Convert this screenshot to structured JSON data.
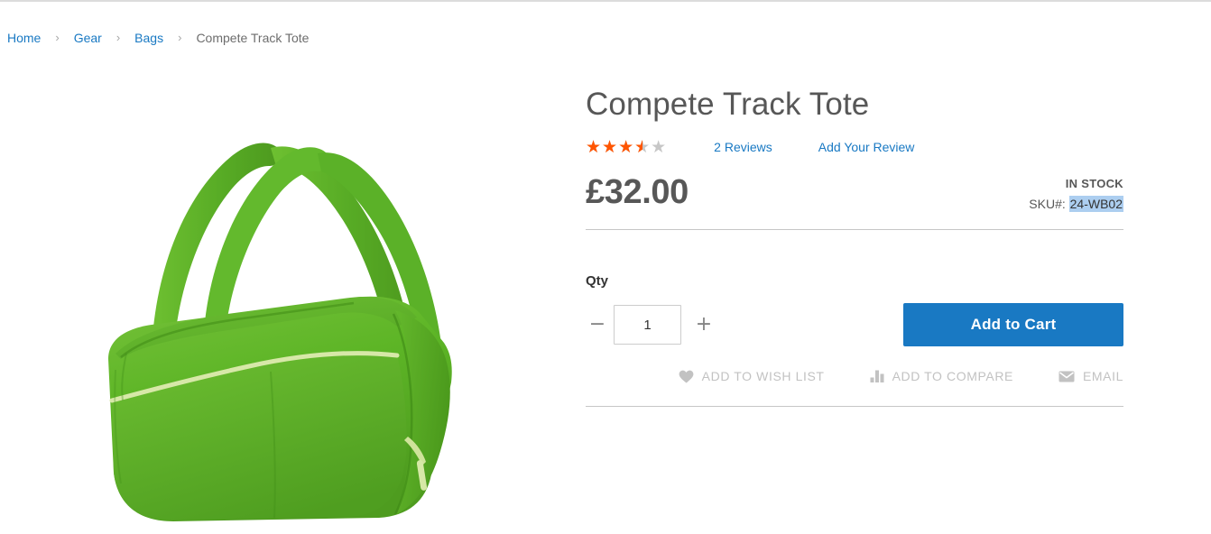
{
  "breadcrumb": {
    "separator": "›",
    "items": [
      {
        "label": "Home",
        "type": "link"
      },
      {
        "label": "Gear",
        "type": "link"
      },
      {
        "label": "Bags",
        "type": "link"
      },
      {
        "label": "Compete Track Tote",
        "type": "current"
      }
    ]
  },
  "product": {
    "title": "Compete Track Tote",
    "image_alt": "Compete Track Tote green duffel bag",
    "rating": {
      "stars_glyphs": "★★★★★",
      "value": 3.5,
      "max": 5,
      "percent": "70%",
      "filled_color": "#ff5501",
      "empty_color": "#c7c7c7"
    },
    "reviews_link": "2 Reviews",
    "add_review_link": "Add Your Review",
    "price": "£32.00",
    "stock_status": "IN STOCK",
    "sku_label": "SKU#:",
    "sku_value": "24-WB02",
    "sku_highlight_color": "#accef0"
  },
  "purchase": {
    "qty_label": "Qty",
    "qty_value": "1",
    "qty_decrease": "−",
    "qty_increase": "+",
    "add_to_cart_label": "Add to Cart",
    "add_to_cart_color": "#1979c3"
  },
  "actions": [
    {
      "label": "Add to Wish List",
      "icon": "heart-icon"
    },
    {
      "label": "Add to Compare",
      "icon": "bar-chart-icon"
    },
    {
      "label": "Email",
      "icon": "envelope-icon"
    }
  ],
  "theme": {
    "link_color": "#1979c3",
    "text_color": "#575757",
    "muted_color": "#c2c2c2",
    "divider_color": "#c6c6c6",
    "product_color": "#5cb22a"
  }
}
